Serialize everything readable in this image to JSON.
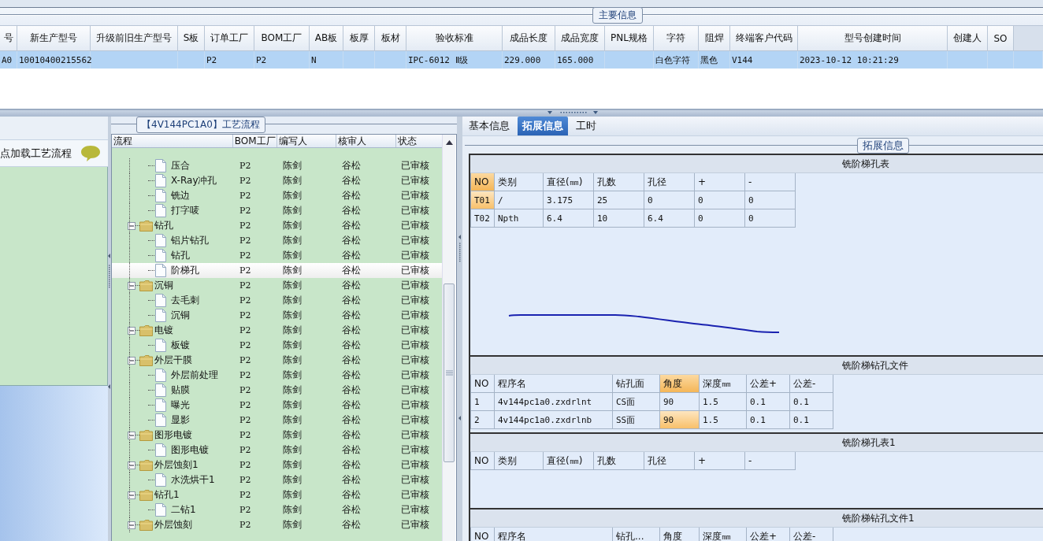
{
  "main_info": {
    "caption": "主要信息",
    "columns": [
      {
        "label": "号",
        "cell": "A0"
      },
      {
        "label": "新生产型号",
        "cell": "10010400215562"
      },
      {
        "label": "升级前旧生产型号"
      },
      {
        "label": "S板"
      },
      {
        "label": "订单工厂",
        "cell": "P2"
      },
      {
        "label": "BOM工厂",
        "cell": "P2"
      },
      {
        "label": "AB板",
        "cell": "N"
      },
      {
        "label": "板厚"
      },
      {
        "label": "板材"
      },
      {
        "label": "验收标准",
        "cell": "IPC-6012 Ⅱ级"
      },
      {
        "label": "成品长度",
        "cell": "229.000"
      },
      {
        "label": "成品宽度",
        "cell": "165.000"
      },
      {
        "label": "PNL规格"
      },
      {
        "label": "字符",
        "cell": "白色字符"
      },
      {
        "label": "阻焊",
        "cell": "黑色"
      },
      {
        "label": "终端客户代码",
        "cell": "V144"
      },
      {
        "label": "型号创建时间",
        "cell": "2023-10-12 10:21:29"
      },
      {
        "label": "创建人"
      },
      {
        "label": "SO"
      }
    ],
    "row_selected": true
  },
  "left_panel": {
    "button": "点加载工艺流程"
  },
  "process_flow": {
    "caption": "【4V144PC1A0】工艺流程",
    "columns": [
      "流程",
      "BOM工厂",
      "编写人",
      "核审人",
      "状态"
    ],
    "items": [
      {
        "kind": "scrolled_parent",
        "children": [
          {
            "kind": "step",
            "label": "压合",
            "bom": "P2",
            "author": "陈剑",
            "reviewer": "谷松",
            "status": "已审核",
            "selected": false
          },
          {
            "kind": "step",
            "label": "X-Ray冲孔",
            "bom": "P2",
            "author": "陈剑",
            "reviewer": "谷松",
            "status": "已审核",
            "selected": false
          },
          {
            "kind": "step",
            "label": "铣边",
            "bom": "P2",
            "author": "陈剑",
            "reviewer": "谷松",
            "status": "已审核",
            "selected": false
          },
          {
            "kind": "step",
            "label": "打字唛",
            "bom": "P2",
            "author": "陈剑",
            "reviewer": "谷松",
            "status": "已审核",
            "selected": false
          }
        ]
      },
      {
        "kind": "folder",
        "label": "钻孔",
        "bom": "P2",
        "author": "陈剑",
        "reviewer": "谷松",
        "status": "已审核",
        "selected": false,
        "expanded": true,
        "children": [
          {
            "kind": "step",
            "label": "铝片钻孔",
            "bom": "P2",
            "author": "陈剑",
            "reviewer": "谷松",
            "status": "已审核",
            "selected": false
          },
          {
            "kind": "step",
            "label": "钻孔",
            "bom": "P2",
            "author": "陈剑",
            "reviewer": "谷松",
            "status": "已审核",
            "selected": false
          },
          {
            "kind": "step",
            "label": "阶梯孔",
            "bom": "P2",
            "author": "陈剑",
            "reviewer": "谷松",
            "status": "已审核",
            "selected": true
          }
        ]
      },
      {
        "kind": "folder",
        "label": "沉铜",
        "bom": "P2",
        "author": "陈剑",
        "reviewer": "谷松",
        "status": "已审核",
        "selected": false,
        "expanded": true,
        "children": [
          {
            "kind": "step",
            "label": "去毛刺",
            "bom": "P2",
            "author": "陈剑",
            "reviewer": "谷松",
            "status": "已审核",
            "selected": false
          },
          {
            "kind": "step",
            "label": "沉铜",
            "bom": "P2",
            "author": "陈剑",
            "reviewer": "谷松",
            "status": "已审核",
            "selected": false
          }
        ]
      },
      {
        "kind": "folder",
        "label": "电镀",
        "bom": "P2",
        "author": "陈剑",
        "reviewer": "谷松",
        "status": "已审核",
        "selected": false,
        "expanded": true,
        "children": [
          {
            "kind": "step",
            "label": "板镀",
            "bom": "P2",
            "author": "陈剑",
            "reviewer": "谷松",
            "status": "已审核",
            "selected": false
          }
        ]
      },
      {
        "kind": "folder",
        "label": "外层干膜",
        "bom": "P2",
        "author": "陈剑",
        "reviewer": "谷松",
        "status": "已审核",
        "selected": false,
        "expanded": true,
        "children": [
          {
            "kind": "step",
            "label": "外层前处理",
            "bom": "P2",
            "author": "陈剑",
            "reviewer": "谷松",
            "status": "已审核",
            "selected": false
          },
          {
            "kind": "step",
            "label": "贴膜",
            "bom": "P2",
            "author": "陈剑",
            "reviewer": "谷松",
            "status": "已审核",
            "selected": false
          },
          {
            "kind": "step",
            "label": "曝光",
            "bom": "P2",
            "author": "陈剑",
            "reviewer": "谷松",
            "status": "已审核",
            "selected": false
          },
          {
            "kind": "step",
            "label": "显影",
            "bom": "P2",
            "author": "陈剑",
            "reviewer": "谷松",
            "status": "已审核",
            "selected": false
          }
        ]
      },
      {
        "kind": "folder",
        "label": "图形电镀",
        "bom": "P2",
        "author": "陈剑",
        "reviewer": "谷松",
        "status": "已审核",
        "selected": false,
        "expanded": true,
        "children": [
          {
            "kind": "step",
            "label": "图形电镀",
            "bom": "P2",
            "author": "陈剑",
            "reviewer": "谷松",
            "status": "已审核",
            "selected": false
          }
        ]
      },
      {
        "kind": "folder",
        "label": "外层蚀刻1",
        "bom": "P2",
        "author": "陈剑",
        "reviewer": "谷松",
        "status": "已审核",
        "selected": false,
        "expanded": true,
        "children": [
          {
            "kind": "step",
            "label": "水洗烘干1",
            "bom": "P2",
            "author": "陈剑",
            "reviewer": "谷松",
            "status": "已审核",
            "selected": false
          }
        ]
      },
      {
        "kind": "folder",
        "label": "钻孔1",
        "bom": "P2",
        "author": "陈剑",
        "reviewer": "谷松",
        "status": "已审核",
        "selected": false,
        "expanded": true,
        "children": [
          {
            "kind": "step",
            "label": "二钻1",
            "bom": "P2",
            "author": "陈剑",
            "reviewer": "谷松",
            "status": "已审核",
            "selected": false
          }
        ]
      },
      {
        "kind": "folder",
        "label": "外层蚀刻",
        "bom": "P2",
        "author": "陈剑",
        "reviewer": "谷松",
        "status": "已审核",
        "selected": false,
        "expanded": true
      }
    ]
  },
  "detail": {
    "tabs": [
      {
        "label": "基本信息",
        "selected": false
      },
      {
        "label": "拓展信息",
        "selected": true
      },
      {
        "label": "工时",
        "selected": false
      }
    ],
    "caption": "拓展信息",
    "sections": [
      {
        "title": "铣阶梯孔表",
        "kind": "hole",
        "pen_stroke": true,
        "columns": [
          {
            "label": "NO",
            "selected": true
          },
          {
            "label": "类别",
            "selected": false
          },
          {
            "label": "直径(㎜)",
            "selected": false
          },
          {
            "label": "孔数",
            "selected": false
          },
          {
            "label": "孔径",
            "selected": false
          },
          {
            "label": "+",
            "selected": false
          },
          {
            "label": "-",
            "selected": false
          }
        ],
        "rows": [
          {
            "cells": [
              "T01",
              "/",
              "3.175",
              "25",
              "0",
              "0",
              "0"
            ],
            "selected": true
          },
          {
            "cells": [
              "T02",
              "Npth",
              "6.4",
              "10",
              "6.4",
              "0",
              "0"
            ],
            "selected": false
          }
        ]
      },
      {
        "title": "铣阶梯钻孔文件",
        "kind": "file",
        "columns": [
          {
            "label": "NO",
            "selected": false
          },
          {
            "label": "程序名",
            "selected": false
          },
          {
            "label": "钻孔面",
            "selected": false
          },
          {
            "label": "角度",
            "selected": true
          },
          {
            "label": "深度㎜",
            "selected": false
          },
          {
            "label": "公差+",
            "selected": false
          },
          {
            "label": "公差-",
            "selected": false
          }
        ],
        "rows": [
          {
            "cells": [
              "1",
              "4v144pc1a0.zxdrlnt",
              "CS面",
              "90",
              "1.5",
              "0.1",
              "0.1"
            ],
            "selected": false
          },
          {
            "cells": [
              "2",
              "4v144pc1a0.zxdrlnb",
              "SS面",
              "90",
              "1.5",
              "0.1",
              "0.1"
            ],
            "selected": true
          }
        ]
      },
      {
        "title": "铣阶梯孔表1",
        "kind": "hole",
        "columns": [
          {
            "label": "NO",
            "selected": false
          },
          {
            "label": "类别",
            "selected": false
          },
          {
            "label": "直径(㎜)",
            "selected": false
          },
          {
            "label": "孔数",
            "selected": false
          },
          {
            "label": "孔径",
            "selected": false
          },
          {
            "label": "+",
            "selected": false
          },
          {
            "label": "-",
            "selected": false
          }
        ]
      },
      {
        "title": "铣阶梯钻孔文件1",
        "kind": "file",
        "columns": [
          {
            "label": "NO",
            "selected": false
          },
          {
            "label": "程序名",
            "selected": false
          },
          {
            "label": "钻孔...",
            "selected": false
          },
          {
            "label": "角度",
            "selected": false
          },
          {
            "label": "深度㎜",
            "selected": false
          },
          {
            "label": "公差+",
            "selected": false
          },
          {
            "label": "公差-",
            "selected": false
          }
        ]
      }
    ]
  }
}
